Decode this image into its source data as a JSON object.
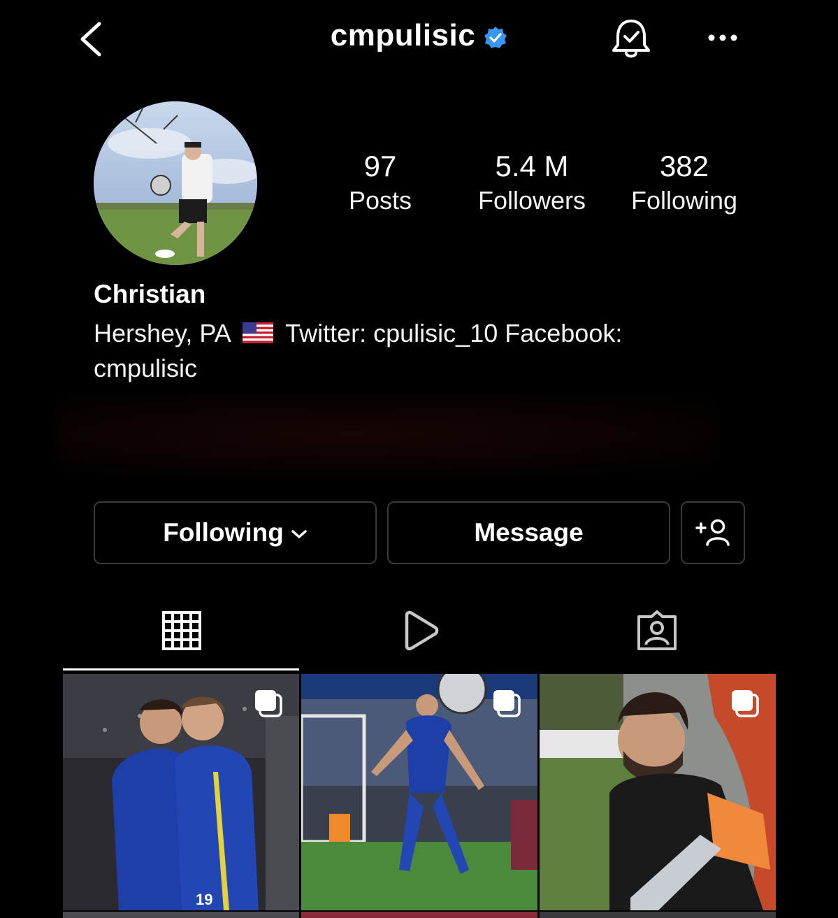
{
  "header": {
    "username": "cmpulisic",
    "verified": true,
    "back_icon": "back-chevron-icon",
    "bell_icon": "bell-check-icon",
    "more_icon": "more-dots-icon"
  },
  "stats": [
    {
      "value": "97",
      "label": "Posts"
    },
    {
      "value": "5.4 M",
      "label": "Followers"
    },
    {
      "value": "382",
      "label": "Following"
    }
  ],
  "bio": {
    "name": "Christian",
    "line_before_flag": "Hershey, PA",
    "line_after_flag": "Twitter: cpulisic_10 Facebook: cmpulisic"
  },
  "actions": {
    "following_label": "Following",
    "message_label": "Message",
    "add_user_icon": "add-person-icon"
  },
  "tabs": [
    {
      "name": "posts-grid",
      "icon": "grid-icon",
      "active": true
    },
    {
      "name": "reels",
      "icon": "play-icon",
      "active": false
    },
    {
      "name": "tagged",
      "icon": "tagged-person-icon",
      "active": false
    }
  ],
  "colors": {
    "background": "#000000",
    "verified_blue": "#3897f0",
    "border": "#3a3a3a"
  }
}
